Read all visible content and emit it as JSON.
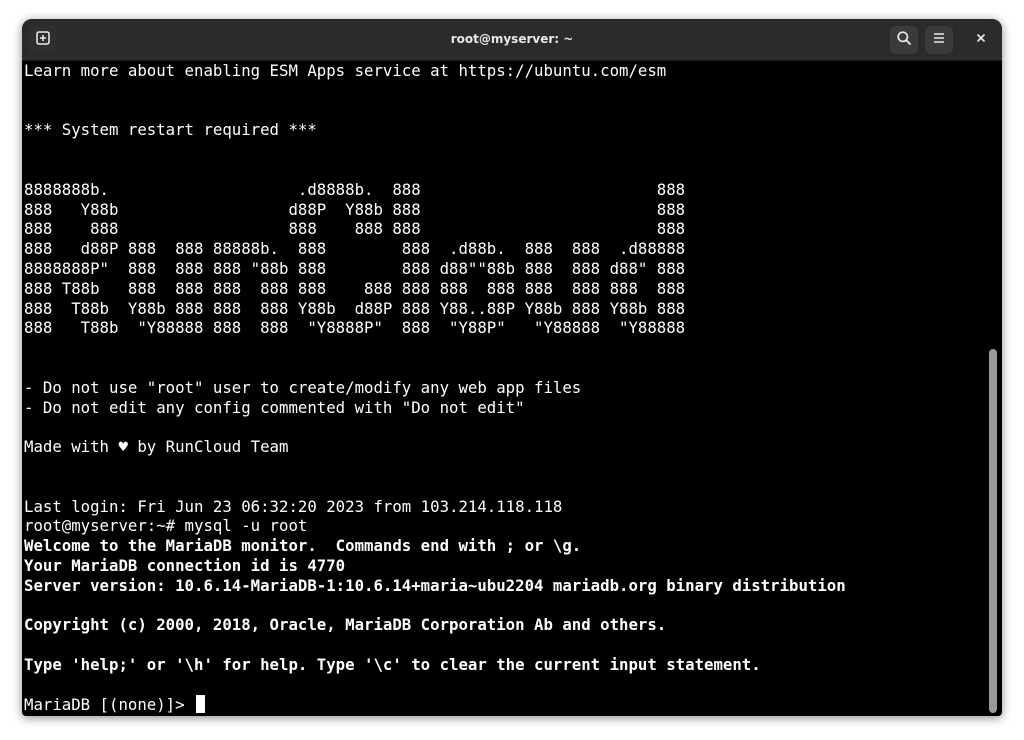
{
  "window": {
    "title": "root@myserver: ~"
  },
  "icons": {
    "new_tab": "new-tab-icon",
    "search": "search-icon",
    "menu": "hamburger-menu-icon",
    "close": "close-icon"
  },
  "colors": {
    "titlebar_bg": "#2b2b2b",
    "terminal_bg": "#000000",
    "terminal_fg": "#ffffff"
  },
  "terminal": {
    "lines": [
      {
        "text": "Learn more about enabling ESM Apps service at https://ubuntu.com/esm",
        "bold": false
      },
      {
        "text": "",
        "bold": false
      },
      {
        "text": "",
        "bold": false
      },
      {
        "text": "*** System restart required ***",
        "bold": false
      },
      {
        "text": "",
        "bold": false
      },
      {
        "text": "",
        "bold": false
      },
      {
        "text": "8888888b.                    .d8888b.  888                         888",
        "bold": false
      },
      {
        "text": "888   Y88b                  d88P  Y88b 888                         888",
        "bold": false
      },
      {
        "text": "888    888                  888    888 888                         888",
        "bold": false
      },
      {
        "text": "888   d88P 888  888 88888b.  888        888  .d88b.  888  888  .d88888",
        "bold": false
      },
      {
        "text": "8888888P\"  888  888 888 \"88b 888        888 d88\"\"88b 888  888 d88\" 888",
        "bold": false
      },
      {
        "text": "888 T88b   888  888 888  888 888    888 888 888  888 888  888 888  888",
        "bold": false
      },
      {
        "text": "888  T88b  Y88b 888 888  888 Y88b  d88P 888 Y88..88P Y88b 888 Y88b 888",
        "bold": false
      },
      {
        "text": "888   T88b  \"Y88888 888  888  \"Y8888P\"  888  \"Y88P\"   \"Y88888  \"Y88888",
        "bold": false
      },
      {
        "text": "",
        "bold": false
      },
      {
        "text": "",
        "bold": false
      },
      {
        "text": "- Do not use \"root\" user to create/modify any web app files",
        "bold": false
      },
      {
        "text": "- Do not edit any config commented with \"Do not edit\"",
        "bold": false
      },
      {
        "text": "",
        "bold": false
      },
      {
        "text": "Made with ♥ by RunCloud Team",
        "bold": false
      },
      {
        "text": "",
        "bold": false
      },
      {
        "text": "",
        "bold": false
      },
      {
        "text": "Last login: Fri Jun 23 06:32:20 2023 from 103.214.118.118",
        "bold": false
      },
      {
        "text": "root@myserver:~# mysql -u root",
        "bold": false
      },
      {
        "text": "Welcome to the MariaDB monitor.  Commands end with ; or \\g.",
        "bold": true
      },
      {
        "text": "Your MariaDB connection id is 4770",
        "bold": true
      },
      {
        "text": "Server version: 10.6.14-MariaDB-1:10.6.14+maria~ubu2204 mariadb.org binary distribution",
        "bold": true
      },
      {
        "text": "",
        "bold": false
      },
      {
        "text": "Copyright (c) 2000, 2018, Oracle, MariaDB Corporation Ab and others.",
        "bold": true
      },
      {
        "text": "",
        "bold": false
      },
      {
        "text": "Type 'help;' or '\\h' for help. Type '\\c' to clear the current input statement.",
        "bold": true
      },
      {
        "text": "",
        "bold": false
      }
    ],
    "prompt": "MariaDB [(none)]> "
  }
}
